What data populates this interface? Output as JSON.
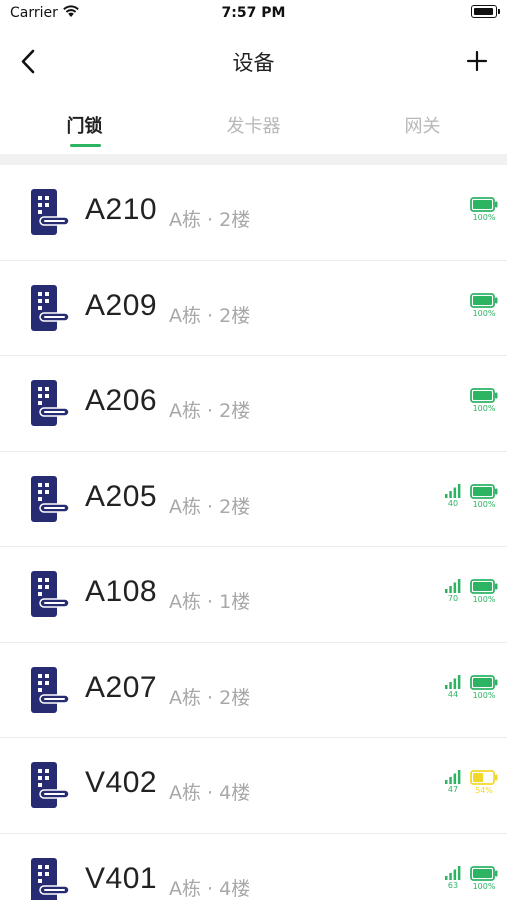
{
  "status_bar": {
    "carrier": "Carrier",
    "time": "7:57 PM"
  },
  "nav": {
    "title": "设备",
    "back_icon": "chevron-left-icon",
    "add_icon": "plus-icon"
  },
  "tabs": [
    {
      "label": "门锁",
      "active": true
    },
    {
      "label": "发卡器",
      "active": false
    },
    {
      "label": "网关",
      "active": false
    }
  ],
  "colors": {
    "accent": "#2cb463",
    "lock_icon": "#262b72",
    "battery_low": "#f2d72b"
  },
  "devices": [
    {
      "name": "A210",
      "location": "A栋 · 2楼",
      "signal": null,
      "battery": "100%",
      "battery_level": 1.0,
      "battery_status": "ok"
    },
    {
      "name": "A209",
      "location": "A栋 · 2楼",
      "signal": null,
      "battery": "100%",
      "battery_level": 1.0,
      "battery_status": "ok"
    },
    {
      "name": "A206",
      "location": "A栋 · 2楼",
      "signal": null,
      "battery": "100%",
      "battery_level": 1.0,
      "battery_status": "ok"
    },
    {
      "name": "A205",
      "location": "A栋 · 2楼",
      "signal": "40",
      "battery": "100%",
      "battery_level": 1.0,
      "battery_status": "ok"
    },
    {
      "name": "A108",
      "location": "A栋 · 1楼",
      "signal": "70",
      "battery": "100%",
      "battery_level": 1.0,
      "battery_status": "ok"
    },
    {
      "name": "A207",
      "location": "A栋 · 2楼",
      "signal": "44",
      "battery": "100%",
      "battery_level": 1.0,
      "battery_status": "ok"
    },
    {
      "name": "V402",
      "location": "A栋 · 4楼",
      "signal": "47",
      "battery": "54%",
      "battery_level": 0.54,
      "battery_status": "low"
    },
    {
      "name": "V401",
      "location": "A栋 · 4楼",
      "signal": "63",
      "battery": "100%",
      "battery_level": 1.0,
      "battery_status": "ok"
    }
  ]
}
